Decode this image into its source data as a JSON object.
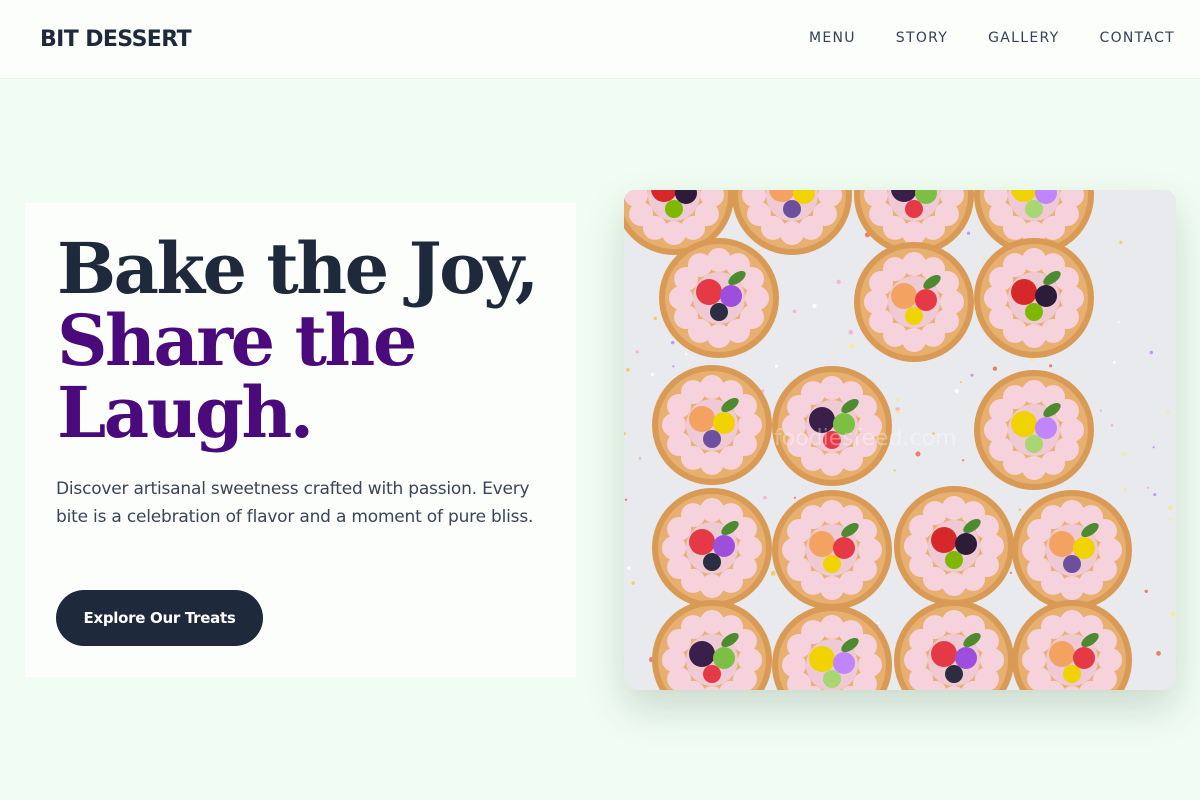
{
  "header": {
    "brand": "BIT DESSERT",
    "nav": [
      {
        "label": "MENU"
      },
      {
        "label": "STORY"
      },
      {
        "label": "GALLERY"
      },
      {
        "label": "CONTACT"
      }
    ]
  },
  "hero": {
    "headline": [
      "Bake the Joy,",
      "Share the",
      "Laugh."
    ],
    "description": "Discover artisanal sweetness crafted with passion. Every bite is a celebration of flavor and a moment of pure bliss.",
    "cta_label": "Explore Our Treats",
    "image": {
      "subject": "tarts-photo",
      "watermark": "foodiesfeed.com"
    }
  },
  "colors": {
    "background": "#f1fdf2",
    "text_dark": "#1e293b",
    "accent_purple": "#4a0a7c",
    "button": "#1e293b"
  }
}
